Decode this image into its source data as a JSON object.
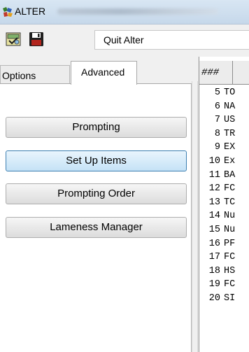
{
  "window": {
    "title": "ALTER",
    "blurred_subtitle": "comp 005 - Enchanted Dairy Sp"
  },
  "toolbar": {
    "quit_label": "Quit Alter"
  },
  "tabs": [
    {
      "label": "Options",
      "active": false
    },
    {
      "label": "Advanced",
      "active": true
    }
  ],
  "advanced": {
    "buttons": [
      {
        "label": "Prompting"
      },
      {
        "label": "Set Up Items"
      },
      {
        "label": "Prompting Order"
      },
      {
        "label": "Lameness Manager"
      }
    ]
  },
  "grid": {
    "header": "###",
    "rows": [
      {
        "num": "5",
        "text": "TO"
      },
      {
        "num": "6",
        "text": "NA"
      },
      {
        "num": "7",
        "text": "US"
      },
      {
        "num": "8",
        "text": "TR"
      },
      {
        "num": "9",
        "text": "EX"
      },
      {
        "num": "10",
        "text": "Ex"
      },
      {
        "num": "11",
        "text": "BA"
      },
      {
        "num": "12",
        "text": "FC"
      },
      {
        "num": "13",
        "text": "TC"
      },
      {
        "num": "14",
        "text": "Nu"
      },
      {
        "num": "15",
        "text": "Nu"
      },
      {
        "num": "16",
        "text": "PF"
      },
      {
        "num": "17",
        "text": "FC"
      },
      {
        "num": "18",
        "text": "HS"
      },
      {
        "num": "19",
        "text": "FC"
      },
      {
        "num": "20",
        "text": "SI"
      }
    ]
  },
  "colors": {
    "hover_button": "#cde6f7",
    "hover_border": "#3c7fb1"
  }
}
